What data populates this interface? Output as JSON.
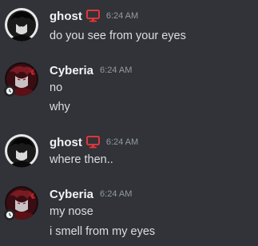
{
  "messages": [
    {
      "author": "ghost",
      "time": "6:24 AM",
      "badge_icon": "monitor-icon",
      "lines": [
        "do you see from your eyes"
      ]
    },
    {
      "author": "Cyberia",
      "time": "6:24 AM",
      "badge_icon": "",
      "lines": [
        "no",
        "why"
      ]
    },
    {
      "author": "ghost",
      "time": "6:24 AM",
      "badge_icon": "monitor-icon",
      "lines": [
        "where then.."
      ]
    },
    {
      "author": "Cyberia",
      "time": "6:24 AM",
      "badge_icon": "",
      "lines": [
        "my nose",
        "i smell from my eyes"
      ]
    }
  ],
  "colors": {
    "background": "#313338",
    "username": "#f2f3f5",
    "text": "#dbdee1",
    "timestamp": "#949ba4",
    "badge": "#e0363a"
  }
}
